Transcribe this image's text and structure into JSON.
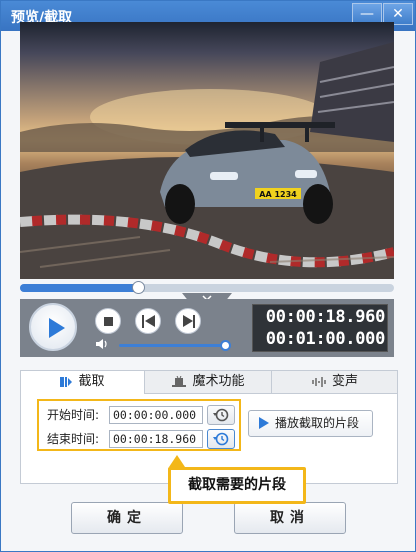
{
  "window": {
    "title": "预览/截取",
    "min_label": "—",
    "close_label": "✕"
  },
  "player": {
    "progress": 0.316,
    "volume": 0.98,
    "current_time": "00:00:18.960",
    "total_time": "00:01:00.000",
    "plate_text": "AA 1234"
  },
  "tabs": [
    {
      "label": "截取",
      "icon": "clip-icon"
    },
    {
      "label": "魔术功能",
      "icon": "magic-hat-icon"
    },
    {
      "label": "变声",
      "icon": "voice-wave-icon"
    }
  ],
  "clip": {
    "start_label": "开始时间:",
    "start_value": "00:00:00.000",
    "end_label": "结束时间:",
    "end_value": "00:00:18.960",
    "play_segment_label": "播放截取的片段",
    "callout": "截取需要的片段"
  },
  "buttons": {
    "ok": "确定",
    "cancel": "取消"
  },
  "colors": {
    "accent": "#3d7fd6",
    "highlight": "#f3b719",
    "titlebar": "#3874c2"
  }
}
